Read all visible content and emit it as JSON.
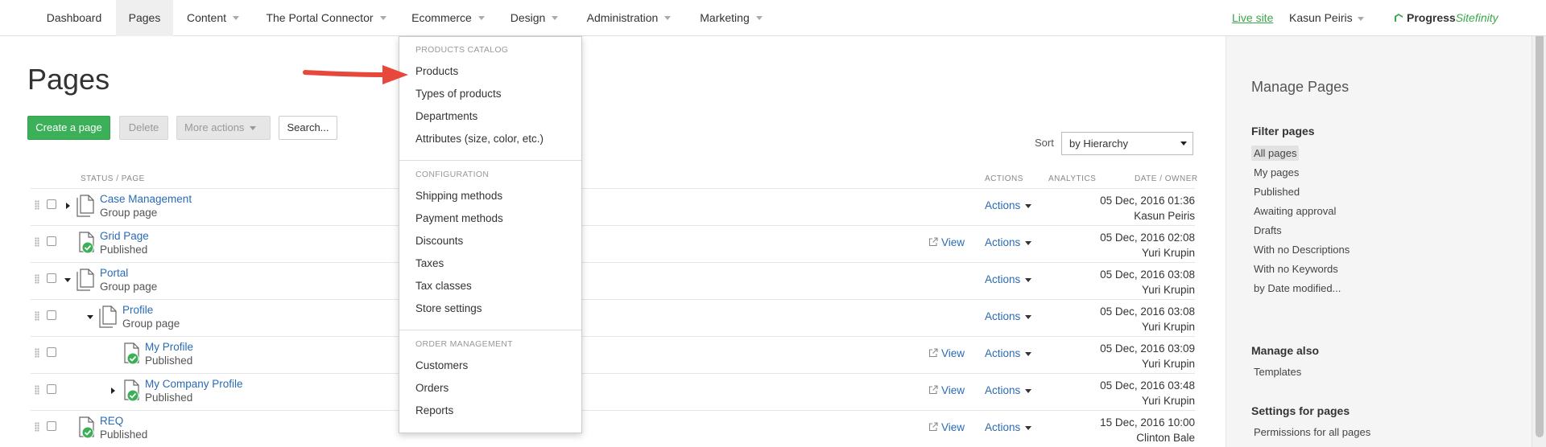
{
  "nav": {
    "items": [
      {
        "label": "Dashboard",
        "caret": false
      },
      {
        "label": "Pages",
        "caret": false,
        "active": true
      },
      {
        "label": "Content",
        "caret": true
      },
      {
        "label": "The Portal Connector",
        "caret": true
      },
      {
        "label": "Ecommerce",
        "caret": true
      },
      {
        "label": "Design",
        "caret": true
      },
      {
        "label": "Administration",
        "caret": true
      },
      {
        "label": "Marketing",
        "caret": true
      }
    ],
    "live_site": "Live site",
    "user": "Kasun Peiris",
    "brand_progress": "Progress",
    "brand_sitefinity": "Sitefinity"
  },
  "page": {
    "title": "Pages",
    "create_button": "Create a page",
    "delete_button": "Delete",
    "more_actions": "More actions",
    "search_button": "Search...",
    "sort_label": "Sort",
    "sort_value": "by Hierarchy"
  },
  "table": {
    "headers": {
      "status_page": "STATUS / PAGE",
      "actions": "ACTIONS",
      "analytics": "ANALYTICS",
      "date_owner": "DATE / OWNER"
    },
    "view_label": "View",
    "actions_label": "Actions",
    "rows": [
      {
        "title": "Case Management",
        "sub": "Group page",
        "date": "05 Dec, 2016 01:36",
        "owner": "Kasun Peiris",
        "published": false,
        "view": false,
        "toggle": "right",
        "indent": 0
      },
      {
        "title": "Grid Page",
        "sub": "Published",
        "date": "05 Dec, 2016 02:08",
        "owner": "Yuri Krupin",
        "published": true,
        "view": true,
        "toggle": "none",
        "indent": 0
      },
      {
        "title": "Portal",
        "sub": "Group page",
        "date": "05 Dec, 2016 03:08",
        "owner": "Yuri Krupin",
        "published": false,
        "view": false,
        "toggle": "down",
        "indent": 0
      },
      {
        "title": "Profile",
        "sub": "Group page",
        "date": "05 Dec, 2016 03:08",
        "owner": "Yuri Krupin",
        "published": false,
        "view": false,
        "toggle": "down",
        "indent": 1
      },
      {
        "title": "My Profile",
        "sub": "Published",
        "date": "05 Dec, 2016 03:09",
        "owner": "Yuri Krupin",
        "published": true,
        "view": true,
        "toggle": "none",
        "indent": 2
      },
      {
        "title": "My Company Profile",
        "sub": "Published",
        "date": "05 Dec, 2016 03:48",
        "owner": "Yuri Krupin",
        "published": true,
        "view": true,
        "toggle": "right",
        "indent": 2
      },
      {
        "title": "REQ",
        "sub": "Published",
        "date": "15 Dec, 2016 10:00",
        "owner": "Clinton Bale",
        "published": true,
        "view": true,
        "toggle": "none",
        "indent": 0
      }
    ]
  },
  "ecommerce_menu": {
    "sections": [
      {
        "heading": "PRODUCTS CATALOG",
        "items": [
          "Products",
          "Types of products",
          "Departments",
          "Attributes (size, color, etc.)"
        ]
      },
      {
        "heading": "CONFIGURATION",
        "items": [
          "Shipping methods",
          "Payment methods",
          "Discounts",
          "Taxes",
          "Tax classes",
          "Store settings"
        ]
      },
      {
        "heading": "ORDER MANAGEMENT",
        "items": [
          "Customers",
          "Orders",
          "Reports"
        ]
      }
    ]
  },
  "sidepanel": {
    "title": "Manage Pages",
    "filter_heading": "Filter pages",
    "filters": [
      "All pages",
      "My pages",
      "Published",
      "Awaiting approval",
      "Drafts",
      "With no Descriptions",
      "With no Keywords",
      "by Date modified..."
    ],
    "manage_also_heading": "Manage also",
    "manage_also": [
      "Templates"
    ],
    "settings_heading": "Settings for pages",
    "settings": [
      "Permissions for all pages"
    ]
  },
  "colors": {
    "primary": "#3bb058",
    "link": "#2a6bb3",
    "annotation_arrow": "#e8483c"
  }
}
